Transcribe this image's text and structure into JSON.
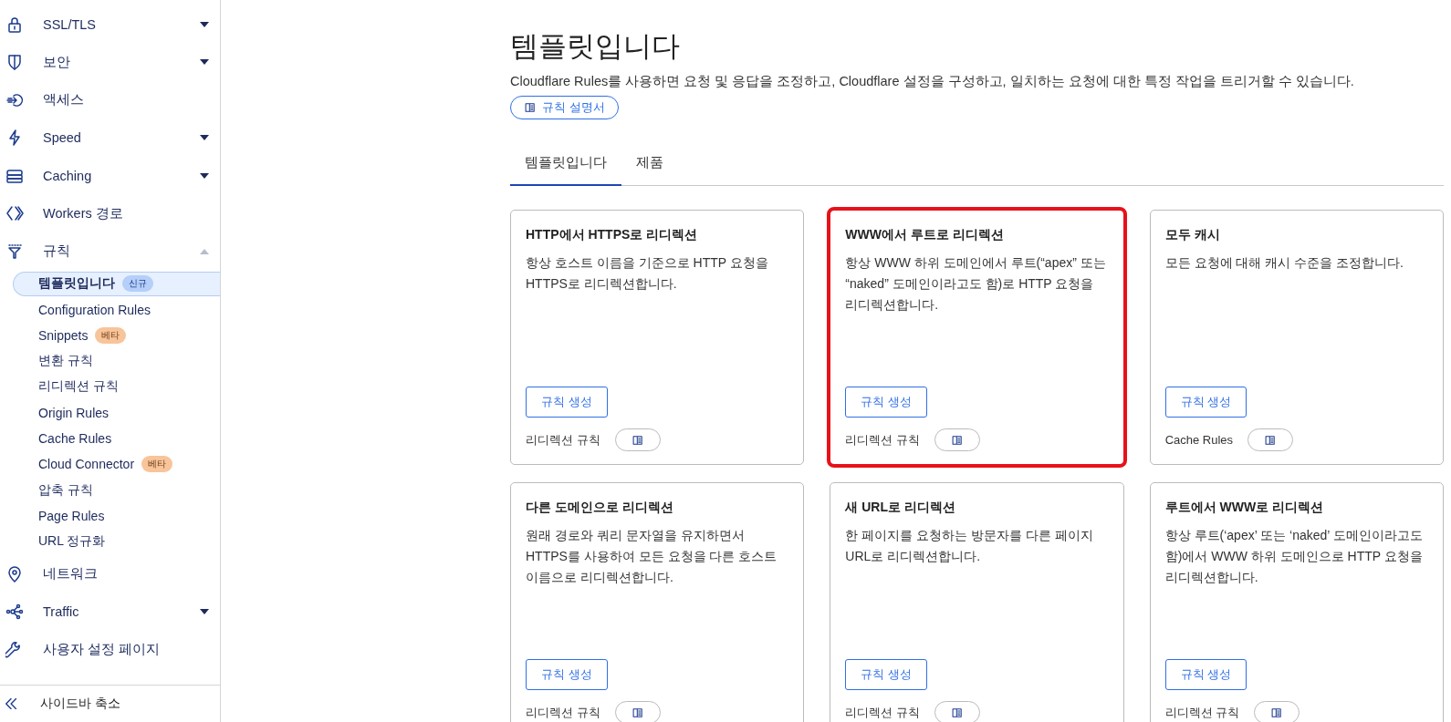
{
  "sidebar": {
    "items": [
      {
        "label": "SSL/TLS",
        "expanded": false
      },
      {
        "label": "보안",
        "expanded": false
      },
      {
        "label": "액세스"
      },
      {
        "label": "Speed",
        "expanded": false
      },
      {
        "label": "Caching",
        "expanded": false
      },
      {
        "label": "Workers 경로"
      },
      {
        "label": "규칙",
        "expanded": true,
        "children": [
          {
            "label": "템플릿입니다",
            "selected": true,
            "badge": {
              "text": "신규",
              "kind": "new"
            }
          },
          {
            "label": "Configuration Rules",
            "selected": false
          },
          {
            "label": "Snippets",
            "selected": false,
            "badge": {
              "text": "베타",
              "kind": "beta"
            }
          },
          {
            "label": "변환 규칙",
            "selected": false
          },
          {
            "label": "리디렉션 규칙",
            "selected": false
          },
          {
            "label": "Origin Rules",
            "selected": false
          },
          {
            "label": "Cache Rules",
            "selected": false
          },
          {
            "label": "Cloud Connector",
            "selected": false,
            "badge": {
              "text": "베타",
              "kind": "beta"
            }
          },
          {
            "label": "압축 규칙",
            "selected": false
          },
          {
            "label": "Page Rules",
            "selected": false
          },
          {
            "label": "URL 정규화",
            "selected": false
          }
        ]
      },
      {
        "label": "네트워크"
      },
      {
        "label": "Traffic",
        "expanded": false
      },
      {
        "label": "사용자 설정 페이지"
      }
    ],
    "collapse": "사이드바 축소"
  },
  "page": {
    "title": "템플릿입니다",
    "description": "Cloudflare Rules를 사용하면 요청 및 응답을 조정하고, Cloudflare 설정을 구성하고, 일치하는 요청에 대한 특정 작업을 트리거할 수 있습니다.",
    "docs_button": "규칙 설명서"
  },
  "tabs": [
    {
      "label": "템플릿입니다",
      "selected": true
    },
    {
      "label": "제품",
      "selected": false
    }
  ],
  "cards": [
    {
      "title": "HTTP에서 HTTPS로 리디렉션",
      "description": "항상 호스트 이름을 기준으로 HTTP 요청을 HTTPS로 리디렉션합니다.",
      "button": "규칙 생성",
      "product": "리디렉션 규칙",
      "highlighted": false
    },
    {
      "title": "WWW에서 루트로 리디렉션",
      "description": "항상 WWW 하위 도메인에서 루트(“apex” 또는 “naked” 도메인이라고도 함)로 HTTP 요청을 리디렉션합니다.",
      "button": "규칙 생성",
      "product": "리디렉션 규칙",
      "highlighted": true
    },
    {
      "title": "모두 캐시",
      "description": "모든 요청에 대해 캐시 수준을 조정합니다.",
      "button": "규칙 생성",
      "product": "Cache Rules",
      "highlighted": false
    },
    {
      "title": "다른 도메인으로 리디렉션",
      "description": "원래 경로와 쿼리 문자열을 유지하면서 HTTPS를 사용하여 모든 요청을 다른 호스트 이름으로 리디렉션합니다.",
      "button": "규칙 생성",
      "product": "리디렉션 규칙",
      "highlighted": false
    },
    {
      "title": "새 URL로 리디렉션",
      "description": "한 페이지를 요청하는 방문자를 다른 페이지 URL로 리디렉션합니다.",
      "button": "규칙 생성",
      "product": "리디렉션 규칙",
      "highlighted": false
    },
    {
      "title": "루트에서 WWW로 리디렉션",
      "description": "항상 루트(‘apex’ 또는 ‘naked’ 도메인이라고도 함)에서 WWW 하위 도메인으로 HTTP 요청을 리디렉션합니다.",
      "button": "규칙 생성",
      "product": "리디렉션 규칙",
      "highlighted": false
    }
  ]
}
